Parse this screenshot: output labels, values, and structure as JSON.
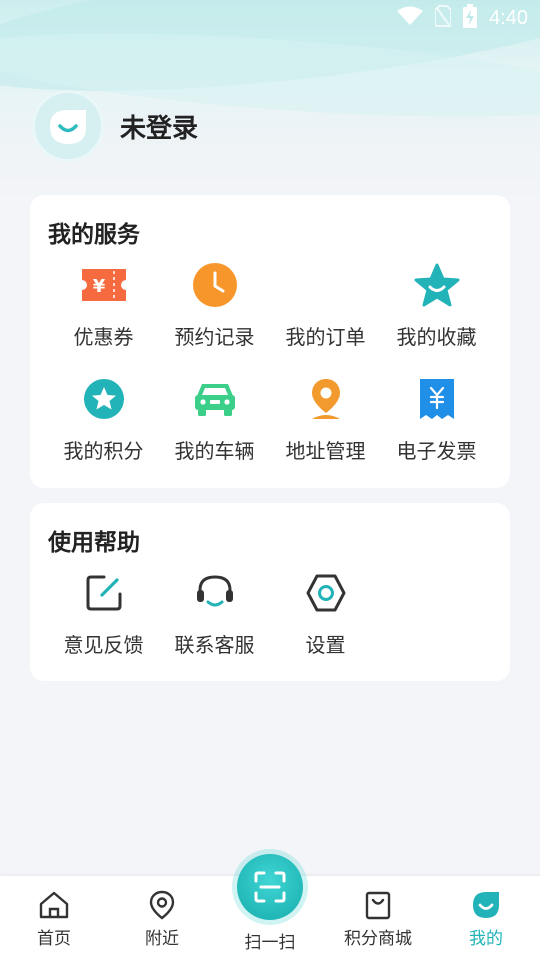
{
  "status_bar": {
    "time": "4:40"
  },
  "profile": {
    "name": "未登录"
  },
  "services": {
    "title": "我的服务",
    "items": [
      {
        "label": "优惠券",
        "icon": "coupon-icon"
      },
      {
        "label": "预约记录",
        "icon": "clock-icon"
      },
      {
        "label": "我的订单",
        "icon": "order-icon"
      },
      {
        "label": "我的收藏",
        "icon": "star-icon"
      },
      {
        "label": "我的积分",
        "icon": "points-icon"
      },
      {
        "label": "我的车辆",
        "icon": "car-icon"
      },
      {
        "label": "地址管理",
        "icon": "location-icon"
      },
      {
        "label": "电子发票",
        "icon": "invoice-icon"
      }
    ]
  },
  "help": {
    "title": "使用帮助",
    "items": [
      {
        "label": "意见反馈",
        "icon": "feedback-icon"
      },
      {
        "label": "联系客服",
        "icon": "headset-icon"
      },
      {
        "label": "设置",
        "icon": "settings-icon"
      }
    ]
  },
  "tabbar": {
    "items": [
      {
        "label": "首页",
        "icon": "home-icon"
      },
      {
        "label": "附近",
        "icon": "map-pin-icon"
      },
      {
        "label": "扫一扫",
        "icon": "scan-icon"
      },
      {
        "label": "积分商城",
        "icon": "shopping-bag-icon"
      },
      {
        "label": "我的",
        "icon": "profile-icon"
      }
    ],
    "active": "我的"
  },
  "colors": {
    "accent": "#22b3b8",
    "coupon": "#f56a3e",
    "clock": "#f7962b",
    "car": "#3ccf8a",
    "location": "#f39a2e",
    "invoice": "#1f8fe8"
  }
}
